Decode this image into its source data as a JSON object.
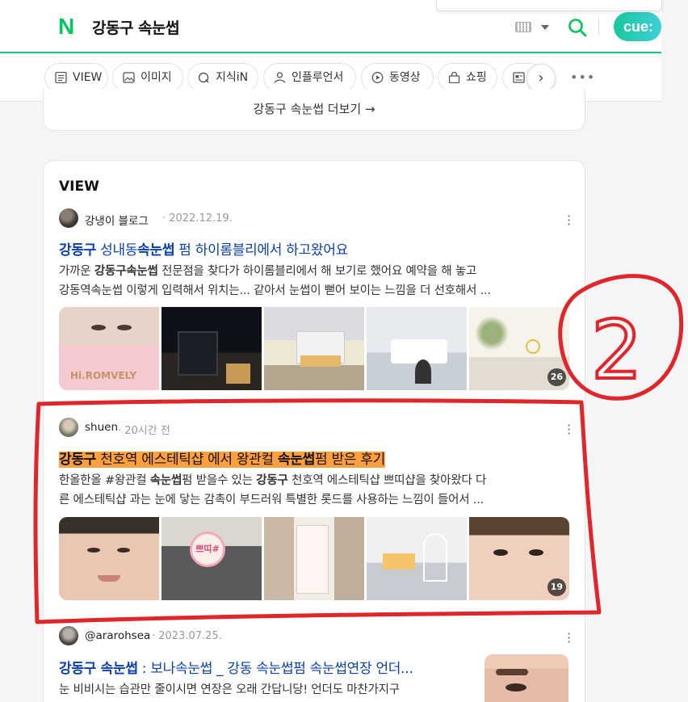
{
  "header": {
    "logo": "N",
    "query": "강동구 속눈썹",
    "cue_label": "cue:"
  },
  "tabs": [
    {
      "label": "VIEW",
      "icon": "document-icon"
    },
    {
      "label": "이미지",
      "icon": "image-icon"
    },
    {
      "label": "지식iN",
      "icon": "q-icon"
    },
    {
      "label": "인플루언서",
      "icon": "person-icon"
    },
    {
      "label": "동영상",
      "icon": "play-icon"
    },
    {
      "label": "쇼핑",
      "icon": "bag-icon"
    },
    {
      "label": "",
      "icon": "news-icon"
    }
  ],
  "more_section": {
    "label": "강동구 속눈썹 더보기 →"
  },
  "view_section": {
    "title": "VIEW",
    "posts": [
      {
        "author": "강냉이 블로그",
        "date": "· 2022.12.19.",
        "title_parts": [
          "강동구",
          " 성내동",
          "속눈썹",
          " 펌 하이롬블리에서 하고왔어요"
        ],
        "snippet_line1": [
          "가까운 ",
          "강동구속눈썹",
          " 전문점을 찾다가 하이롬블리에서 해 보기로 했어요 예약을 해 놓고"
        ],
        "snippet_line2": "강동역속눈썹 이렇게 입력해서 위치는... 같아서 눈썹이 뻗어 보이는 느낌을 더 선호해서 ...",
        "image_count": "26",
        "thumb_text": "Hi.ROMVELY"
      },
      {
        "author": "shuen",
        "date": "· 20시간 전",
        "title_parts": [
          "강동구",
          " 천호역 에스테틱샵 에서 왕관컬 ",
          "속눈썹",
          "펌 받은 후기"
        ],
        "snippet_line1": [
          "한올한올 #왕관컬 ",
          "속눈썹",
          "펌 받을수 있는 ",
          "강동구",
          " 천호역 에스테틱샵 쁘띠샵을 찾아왔다 다"
        ],
        "snippet_line2": "른 에스테틱샵 과는 눈에 닿는 감촉이 부드러워 특별한 롯드를 사용하는 느낌이 들어서 ...",
        "image_count": "19",
        "thumb_text": "쁘띠#"
      },
      {
        "author": "@ararohsea",
        "date": "· 2023.07.25.",
        "title_parts": [
          "강동구 속눈썹",
          " : 보나속눈썹 _ 강동 속눈썹펌 속눈썹연장 언더..."
        ],
        "snippet_line1": "눈 비비시는 습관만 줄이시면 연장은 오래 간답니당! 언더도 마찬가지구"
      }
    ]
  },
  "annotation": {
    "number_label": "2",
    "color": "#e0262a"
  },
  "colors": {
    "accent": "#03c75a",
    "link": "#0a3fad",
    "highlight": "#ff9f3f"
  }
}
